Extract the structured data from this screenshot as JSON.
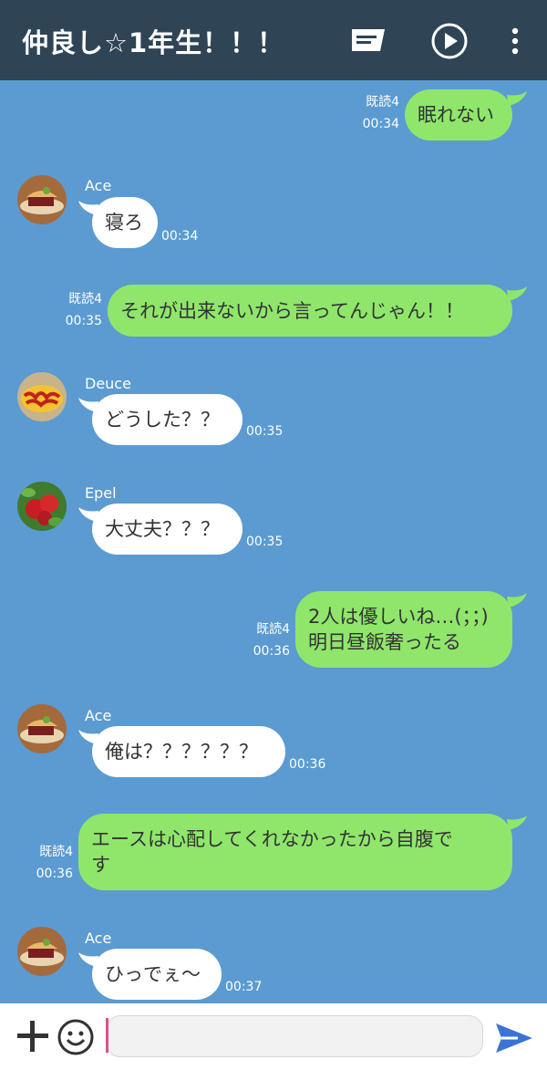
{
  "header": {
    "title": "仲良し☆1年生！！！",
    "icons": [
      "note-icon",
      "play-circle-icon",
      "more-vertical-icon"
    ]
  },
  "messages": [
    {
      "id": "m1",
      "side": "me",
      "text": "眠れない",
      "read": "既読4",
      "time": "00:34"
    },
    {
      "id": "m2",
      "side": "them",
      "sender": "Ace",
      "avatar": "apple-pie-icon",
      "text": "寝ろ",
      "time": "00:34"
    },
    {
      "id": "m3",
      "side": "me",
      "text": "それが出来ないから言ってんじゃん！！",
      "read": "既読4",
      "time": "00:35"
    },
    {
      "id": "m4",
      "side": "them",
      "sender": "Deuce",
      "avatar": "omurice-icon",
      "text": "どうした？？",
      "time": "00:35"
    },
    {
      "id": "m5",
      "side": "them",
      "sender": "Epel",
      "avatar": "apple-icon",
      "text": "大丈夫？？？",
      "time": "00:35"
    },
    {
      "id": "m6",
      "side": "me",
      "text_line1": "2人は優しいね…(；；)",
      "text_line2": "明日昼飯奢ったる",
      "read": "既読4",
      "time": "00:36"
    },
    {
      "id": "m7",
      "side": "them",
      "sender": "Ace",
      "avatar": "apple-pie-icon",
      "text": "俺は？？？？？？",
      "time": "00:36"
    },
    {
      "id": "m8",
      "side": "me",
      "text_line1": "エースは心配してくれなかったから自腹で",
      "text_line2": "す",
      "read": "既読4",
      "time": "00:36"
    },
    {
      "id": "m9",
      "side": "them",
      "sender": "Ace",
      "avatar": "apple-pie-icon",
      "text": "ひっでぇ～",
      "time": "00:37"
    }
  ],
  "input": {
    "placeholder": "",
    "icons": [
      "plus-icon",
      "emoji-icon",
      "send-icon"
    ]
  },
  "colors": {
    "header_bg": "#2f4455",
    "chat_bg": "#5b9bd1",
    "my_bubble": "#8fe66b",
    "their_bubble": "#ffffff",
    "send_icon": "#3b73d6",
    "cursor": "#e04f8c"
  }
}
